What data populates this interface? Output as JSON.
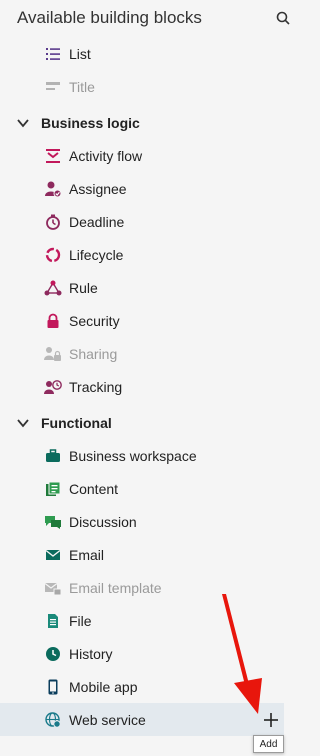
{
  "panel": {
    "title": "Available building blocks",
    "items_top": [
      {
        "label": "List",
        "icon": "list-icon",
        "disabled": false
      },
      {
        "label": "Title",
        "icon": "title-icon",
        "disabled": true
      }
    ],
    "sections": [
      {
        "label": "Business logic",
        "items": [
          {
            "label": "Activity flow",
            "icon": "activity-flow-icon",
            "disabled": false
          },
          {
            "label": "Assignee",
            "icon": "assignee-icon",
            "disabled": false
          },
          {
            "label": "Deadline",
            "icon": "deadline-icon",
            "disabled": false
          },
          {
            "label": "Lifecycle",
            "icon": "lifecycle-icon",
            "disabled": false
          },
          {
            "label": "Rule",
            "icon": "rule-icon",
            "disabled": false
          },
          {
            "label": "Security",
            "icon": "lock-icon",
            "disabled": false
          },
          {
            "label": "Sharing",
            "icon": "sharing-icon",
            "disabled": true
          },
          {
            "label": "Tracking",
            "icon": "tracking-icon",
            "disabled": false
          }
        ]
      },
      {
        "label": "Functional",
        "items": [
          {
            "label": "Business workspace",
            "icon": "briefcase-icon",
            "disabled": false
          },
          {
            "label": "Content",
            "icon": "content-icon",
            "disabled": false
          },
          {
            "label": "Discussion",
            "icon": "discussion-icon",
            "disabled": false
          },
          {
            "label": "Email",
            "icon": "email-icon",
            "disabled": false
          },
          {
            "label": "Email template",
            "icon": "email-template-icon",
            "disabled": true
          },
          {
            "label": "File",
            "icon": "file-icon",
            "disabled": false
          },
          {
            "label": "History",
            "icon": "history-icon",
            "disabled": false
          },
          {
            "label": "Mobile app",
            "icon": "mobile-icon",
            "disabled": false
          },
          {
            "label": "Web service",
            "icon": "web-service-icon",
            "disabled": false,
            "selected": true
          }
        ]
      }
    ],
    "add_tooltip": "Add"
  }
}
